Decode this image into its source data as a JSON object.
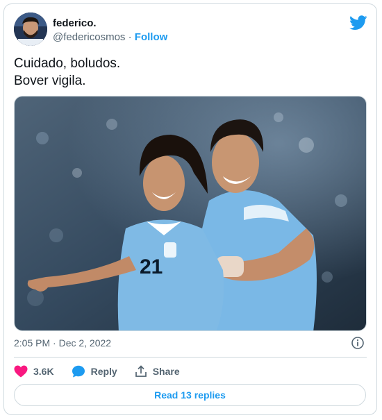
{
  "author": {
    "display_name": "federico.",
    "handle": "@federicosmos",
    "separator": " · ",
    "follow_label": "Follow"
  },
  "tweet": {
    "text": "Cuidado, boludos.\nBover vigila.",
    "timestamp": "2:05 PM · Dec 2, 2022"
  },
  "media": {
    "description_alt": "",
    "jersey_number": "21"
  },
  "actions": {
    "likes": "3.6K",
    "reply_label": "Reply",
    "share_label": "Share"
  },
  "replies_button": "Read 13 replies",
  "colors": {
    "brand": "#1d9bf0",
    "like": "#f91880",
    "text_secondary": "#536471",
    "border": "#cfd9de"
  },
  "icons": [
    "twitter-bird-icon",
    "info-icon",
    "heart-icon",
    "reply-bubble-icon",
    "share-icon"
  ]
}
